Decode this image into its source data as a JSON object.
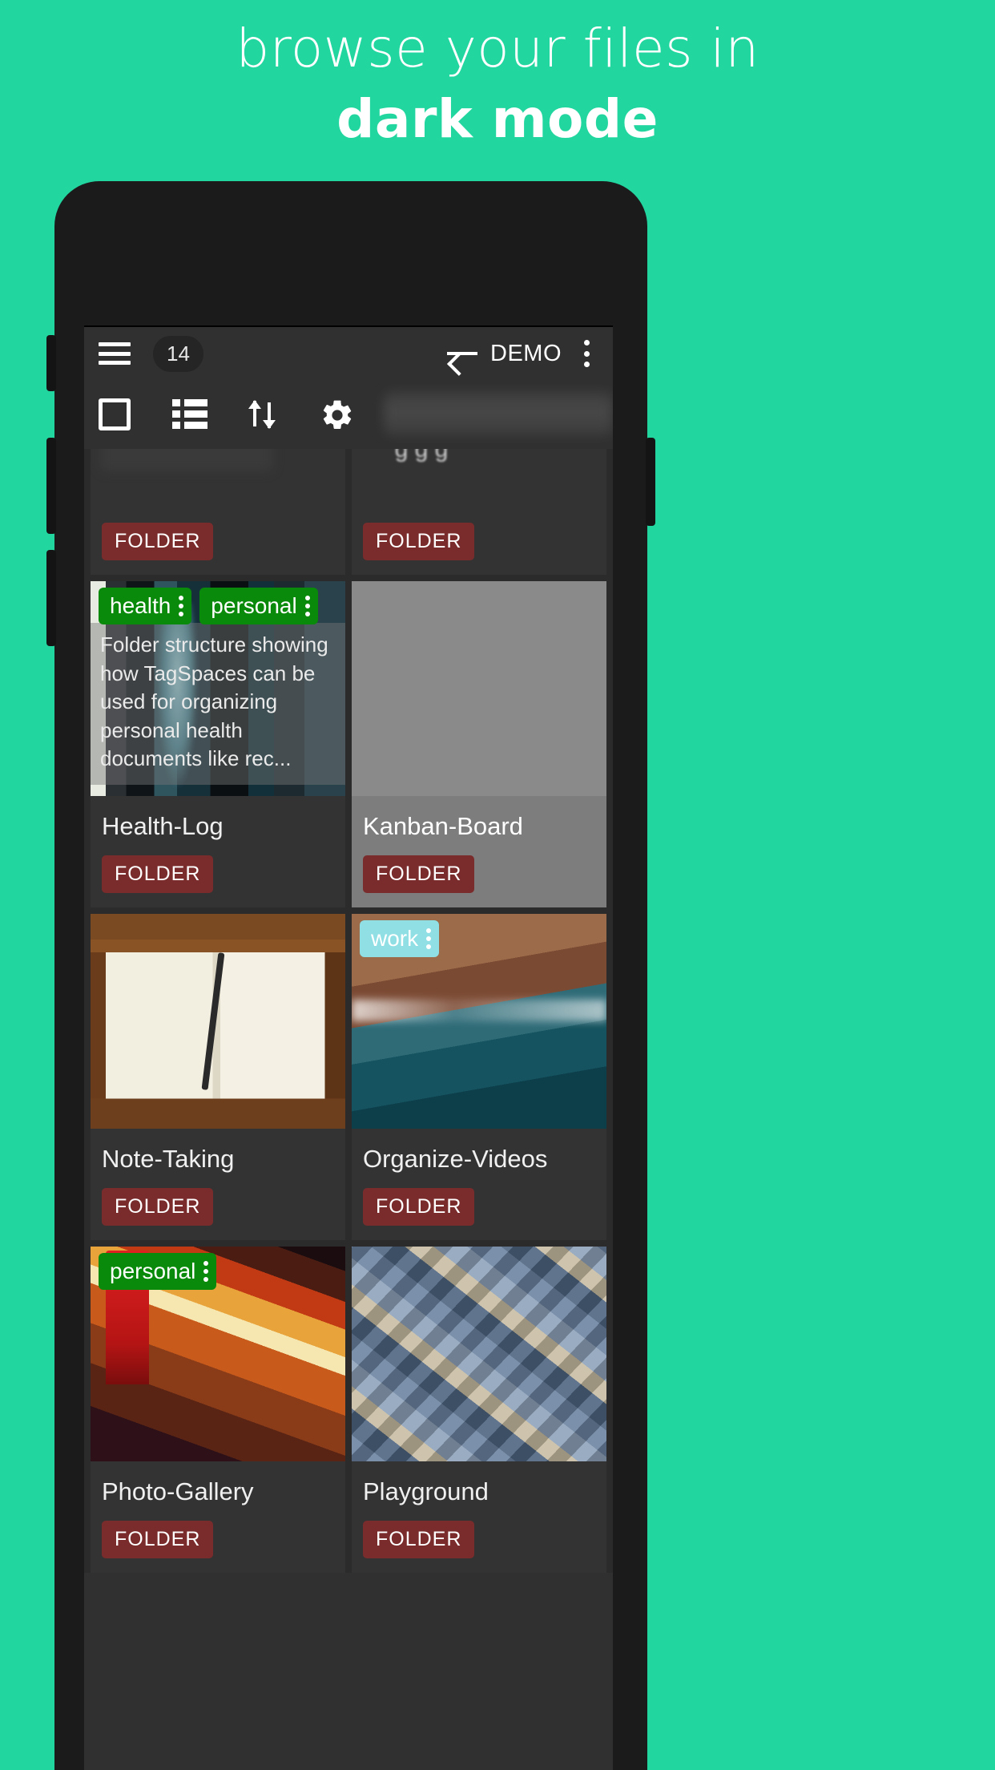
{
  "headline": {
    "line1": "browse your files in",
    "line2": "dark mode"
  },
  "colors": {
    "background": "#22D6A0",
    "screen_bg": "#303030",
    "card_bg": "#333333",
    "folder_badge": "#7a2c2c",
    "tag_green": "#0a8a0a",
    "tag_cyan": "#8fdfe4"
  },
  "appbar": {
    "menu_icon": "hamburger-menu-icon",
    "count_badge": "14",
    "back_icon": "arrow-left-icon",
    "title": "DEMO",
    "overflow_icon": "more-vertical-icon"
  },
  "toolbar": {
    "items": [
      {
        "icon": "square-outline-icon",
        "name": "grid-view-button"
      },
      {
        "icon": "list-icon",
        "name": "list-view-button"
      },
      {
        "icon": "sort-arrows-icon",
        "name": "sort-button"
      },
      {
        "icon": "gear-icon",
        "name": "settings-button"
      }
    ]
  },
  "folder_badge_label": "FOLDER",
  "grid": {
    "partial_top_row": [
      {
        "title": "",
        "badge": "FOLDER"
      },
      {
        "title": "",
        "badge": "FOLDER"
      }
    ],
    "cards": [
      {
        "title": "Health-Log",
        "badge": "FOLDER",
        "image": "xray-documents-thumbnail",
        "tags": [
          {
            "label": "health",
            "color": "green"
          },
          {
            "label": "personal",
            "color": "green"
          }
        ],
        "description": "Folder structure showing how TagSpaces can be used for organizing personal health documents like rec..."
      },
      {
        "title": "Kanban-Board",
        "badge": "FOLDER",
        "image": "",
        "tags": [],
        "description": ""
      },
      {
        "title": "Note-Taking",
        "badge": "FOLDER",
        "image": "notebook-pencil-thumbnail",
        "tags": [],
        "description": ""
      },
      {
        "title": "Organize-Videos",
        "badge": "FOLDER",
        "image": "aerial-coastline-thumbnail",
        "tags": [
          {
            "label": "work",
            "color": "cyan"
          }
        ],
        "description": ""
      },
      {
        "title": "Photo-Gallery",
        "badge": "FOLDER",
        "image": "london-phonebooth-thumbnail",
        "tags": [
          {
            "label": "personal",
            "color": "green"
          }
        ],
        "description": ""
      },
      {
        "title": "Playground",
        "badge": "FOLDER",
        "image": "letterpress-blocks-thumbnail",
        "tags": [],
        "description": ""
      }
    ]
  }
}
